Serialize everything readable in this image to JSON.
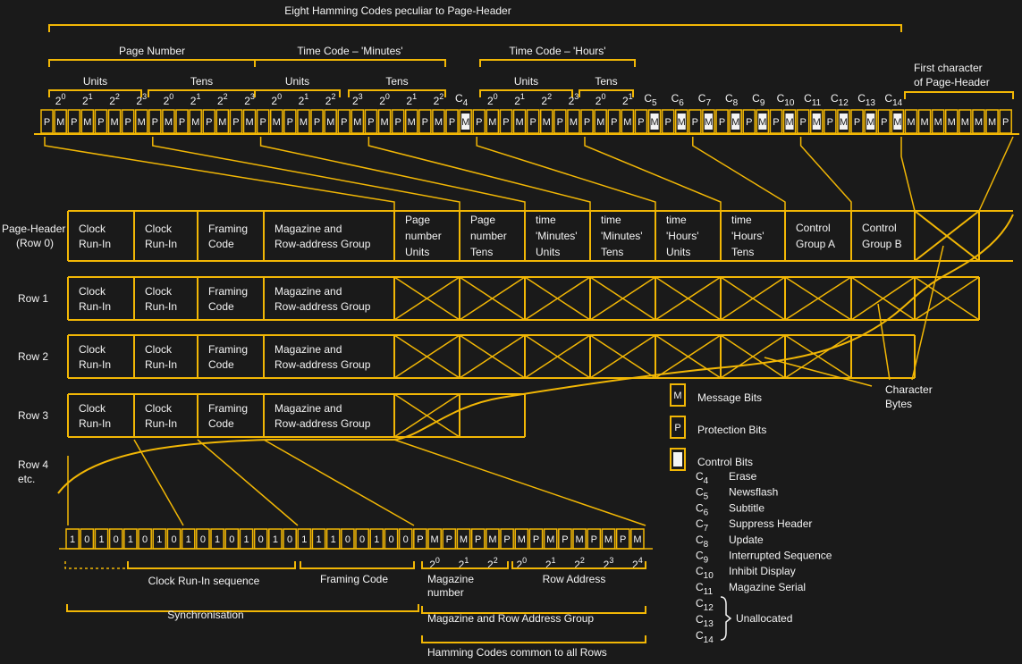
{
  "colors": {
    "background": "#1a1a1a",
    "line": "#f2b705",
    "text": "#f4f4f4"
  },
  "top": {
    "title": "Eight Hamming Codes peculiar to Page-Header",
    "groups": [
      "Page Number",
      "Time Code – 'Minutes'",
      "Time Code – 'Hours'"
    ],
    "subgroups": [
      "Units",
      "Tens",
      "Units",
      "Tens",
      "Units",
      "Tens"
    ],
    "first_char_label": [
      "First character",
      "of Page-Header"
    ],
    "powers": [
      {
        "bit": 1,
        "exp": "0"
      },
      {
        "bit": 3,
        "exp": "1"
      },
      {
        "bit": 5,
        "exp": "2"
      },
      {
        "bit": 7,
        "exp": "3"
      },
      {
        "bit": 9,
        "exp": "0"
      },
      {
        "bit": 11,
        "exp": "1"
      },
      {
        "bit": 13,
        "exp": "2"
      },
      {
        "bit": 15,
        "exp": "3"
      },
      {
        "bit": 17,
        "exp": "0"
      },
      {
        "bit": 19,
        "exp": "1"
      },
      {
        "bit": 21,
        "exp": "2"
      },
      {
        "bit": 23,
        "exp": "3"
      },
      {
        "bit": 25,
        "exp": "0"
      },
      {
        "bit": 27,
        "exp": "1"
      },
      {
        "bit": 29,
        "exp": "2"
      },
      {
        "bit": 33,
        "exp": "0"
      },
      {
        "bit": 35,
        "exp": "1"
      },
      {
        "bit": 37,
        "exp": "2"
      },
      {
        "bit": 39,
        "exp": "3"
      },
      {
        "bit": 41,
        "exp": "0"
      },
      {
        "bit": 43,
        "exp": "1"
      }
    ],
    "control_bits": [
      {
        "bit": 31,
        "label": "4"
      },
      {
        "bit": 45,
        "label": "5"
      },
      {
        "bit": 47,
        "label": "6"
      },
      {
        "bit": 49,
        "label": "7"
      },
      {
        "bit": 51,
        "label": "8"
      },
      {
        "bit": 53,
        "label": "9"
      },
      {
        "bit": 55,
        "label": "10"
      },
      {
        "bit": 57,
        "label": "11"
      },
      {
        "bit": 59,
        "label": "12"
      },
      {
        "bit": 61,
        "label": "13"
      },
      {
        "bit": 63,
        "label": "14"
      }
    ],
    "bits": "PMPMPMPMPMPMPMPMPMPMPMPMPMPMPMPMPMPMPMPMPMPMPMPMPMPMPMPMPMPMPMPMMMMMMMMP"
  },
  "rows": {
    "labels": [
      [
        "Page-Header",
        "(Row 0)"
      ],
      [
        "Row 1"
      ],
      [
        "Row 2"
      ],
      [
        "Row 3"
      ],
      [
        "Row 4",
        "etc."
      ]
    ],
    "common_cells": [
      [
        "Clock",
        "Run-In"
      ],
      [
        "Clock",
        "Run-In"
      ],
      [
        "Framing",
        "Code"
      ],
      [
        "Magazine and",
        "Row-address Group"
      ]
    ],
    "header_cells": [
      [
        "Page",
        "number",
        "Units"
      ],
      [
        "Page",
        "number",
        "Tens"
      ],
      [
        "time",
        "'Minutes'",
        "Units"
      ],
      [
        "time",
        "'Minutes'",
        "Tens"
      ],
      [
        "time",
        "'Hours'",
        "Units"
      ],
      [
        "time",
        "'Hours'",
        "Tens"
      ],
      [
        "Control",
        "Group A"
      ],
      [
        "Control",
        "Group B"
      ]
    ],
    "character_bytes_label": [
      "Character",
      "Bytes"
    ]
  },
  "bottom": {
    "bits": "1010101010101010111001 00PMPMPMPMPMPMPMPM",
    "powers": [
      {
        "bit": 25,
        "exp": "0"
      },
      {
        "bit": 27,
        "exp": "1"
      },
      {
        "bit": 29,
        "exp": "2"
      },
      {
        "bit": 31,
        "exp": "0"
      },
      {
        "bit": 33,
        "exp": "1"
      },
      {
        "bit": 35,
        "exp": "2"
      },
      {
        "bit": 37,
        "exp": "3"
      },
      {
        "bit": 39,
        "exp": "4"
      }
    ],
    "labels": {
      "clock_run_in": "Clock Run-In sequence",
      "framing_code": "Framing Code",
      "magazine_number": [
        "Magazine",
        "number"
      ],
      "row_address": "Row Address",
      "synchronisation": "Synchronisation",
      "mag_row_group": "Magazine and Row Address Group",
      "hamming_common": "Hamming Codes common to all Rows"
    }
  },
  "legend": {
    "items": [
      {
        "glyph": "M",
        "label": "Message Bits"
      },
      {
        "glyph": "P",
        "label": "Protection Bits"
      },
      {
        "glyph": "",
        "label": "Control Bits"
      }
    ],
    "controls": [
      {
        "sub": "4",
        "label": "Erase"
      },
      {
        "sub": "5",
        "label": "Newsflash"
      },
      {
        "sub": "6",
        "label": "Subtitle"
      },
      {
        "sub": "7",
        "label": "Suppress Header"
      },
      {
        "sub": "8",
        "label": "Update"
      },
      {
        "sub": "9",
        "label": "Interrupted Sequence"
      },
      {
        "sub": "10",
        "label": "Inhibit Display"
      },
      {
        "sub": "11",
        "label": "Magazine Serial"
      }
    ],
    "unallocated": {
      "subs": [
        "12",
        "13",
        "14"
      ],
      "label": "Unallocated"
    }
  }
}
